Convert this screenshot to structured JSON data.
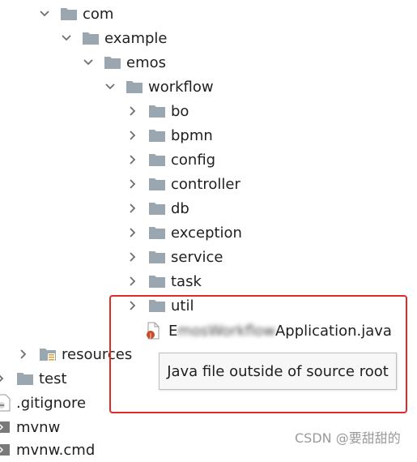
{
  "tree": {
    "com": "com",
    "example": "example",
    "emos": "emos",
    "workflow": "workflow",
    "packages": [
      "bo",
      "bpmn",
      "config",
      "controller",
      "db",
      "exception",
      "service",
      "task",
      "util"
    ],
    "java_file": {
      "prefix": "E",
      "blurred_part": "mosWorkflow",
      "suffix": "Application.java"
    },
    "resources": "resources",
    "test": "test",
    "gitignore": ".gitignore",
    "mvnw": "mvnw",
    "mvnw_cmd": "mvnw.cmd"
  },
  "tooltip": "Java file outside of source root",
  "watermark": "CSDN @要甜甜的",
  "colors": {
    "folder": "#9aa7b0",
    "chevron": "#6e6e6e",
    "highlight": "#e12b26"
  }
}
